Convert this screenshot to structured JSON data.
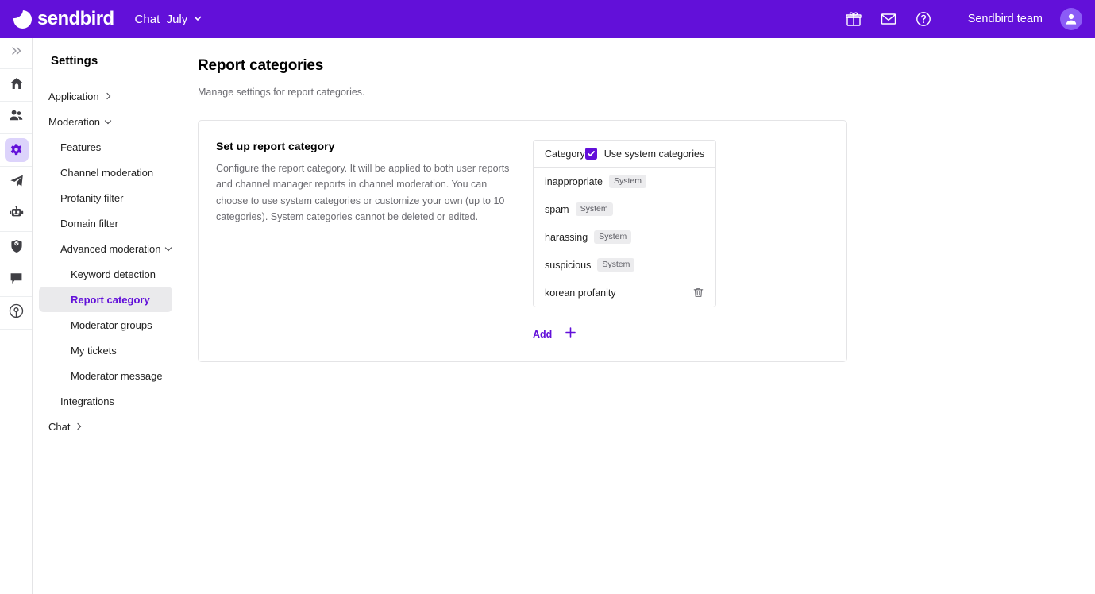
{
  "topbar": {
    "brand": "sendbird",
    "logo_icon": "sendbird-logo-icon",
    "app_name": "Chat_July",
    "app_chevron_icon": "chevron-down-icon",
    "icons": [
      {
        "name": "gift-icon",
        "label": "Gift"
      },
      {
        "name": "envelope-icon",
        "label": "Messages"
      },
      {
        "name": "help-circle-icon",
        "label": "Help"
      }
    ],
    "team_name": "Sendbird team",
    "avatar_icon": "user-avatar-icon",
    "background_color": "#6210d9"
  },
  "rail": {
    "items": [
      {
        "name": "expand-chevrons-icon",
        "label": "Expand",
        "active": false
      },
      {
        "name": "home-icon",
        "label": "Home",
        "active": false
      },
      {
        "name": "users-icon",
        "label": "Users",
        "active": false
      },
      {
        "name": "gear-icon",
        "label": "Settings",
        "active": true
      },
      {
        "name": "paper-plane-icon",
        "label": "Send",
        "active": false
      },
      {
        "name": "robot-icon",
        "label": "Bots",
        "active": false
      },
      {
        "name": "shield-check-icon",
        "label": "Moderation",
        "active": false
      },
      {
        "name": "chat-bubble-icon",
        "label": "Chat",
        "active": false
      },
      {
        "name": "broadcast-icon",
        "label": "Broadcast",
        "active": false
      }
    ],
    "active_background": "#dcd3fb",
    "active_color": "#6210d9"
  },
  "sidebar": {
    "title": "Settings",
    "items": [
      {
        "label": "Application",
        "level": 1,
        "chevron": "right",
        "active": false
      },
      {
        "label": "Moderation",
        "level": 1,
        "chevron": "down",
        "active": false
      },
      {
        "label": "Features",
        "level": 2,
        "chevron": "none",
        "active": false
      },
      {
        "label": "Channel moderation",
        "level": 2,
        "chevron": "none",
        "active": false
      },
      {
        "label": "Profanity filter",
        "level": 2,
        "chevron": "none",
        "active": false
      },
      {
        "label": "Domain filter",
        "level": 2,
        "chevron": "none",
        "active": false
      },
      {
        "label": "Advanced moderation",
        "level": 2,
        "chevron": "down",
        "active": false
      },
      {
        "label": "Keyword detection",
        "level": 3,
        "chevron": "none",
        "active": false
      },
      {
        "label": "Report category",
        "level": 3,
        "chevron": "none",
        "active": true
      },
      {
        "label": "Moderator groups",
        "level": 3,
        "chevron": "none",
        "active": false
      },
      {
        "label": "My tickets",
        "level": 3,
        "chevron": "none",
        "active": false
      },
      {
        "label": "Moderator message",
        "level": 3,
        "chevron": "none",
        "active": false
      },
      {
        "label": "Integrations",
        "level": 2,
        "chevron": "none",
        "active": false
      },
      {
        "label": "Chat",
        "level": 1,
        "chevron": "right",
        "active": false
      }
    ]
  },
  "main": {
    "page_title": "Report categories",
    "page_subtitle": "Manage settings for report categories.",
    "card": {
      "heading": "Set up report category",
      "description": "Configure the report category. It will be applied to both user reports and channel manager reports in channel moderation. You can choose to use system categories or customize your own (up to 10 categories). System categories cannot be deleted or edited.",
      "panel": {
        "column_header": "Category",
        "use_system_label": "Use system categories",
        "use_system_checked": true,
        "checkbox_color": "#6210d9",
        "rows": [
          {
            "name": "inappropriate",
            "badge": "System",
            "deletable": false
          },
          {
            "name": "spam",
            "badge": "System",
            "deletable": false
          },
          {
            "name": "harassing",
            "badge": "System",
            "deletable": false
          },
          {
            "name": "suspicious",
            "badge": "System",
            "deletable": false
          },
          {
            "name": "korean profanity",
            "badge": "",
            "deletable": true
          }
        ]
      },
      "add_label": "Add",
      "add_icon": "plus-icon",
      "add_color": "#6210d9"
    }
  }
}
